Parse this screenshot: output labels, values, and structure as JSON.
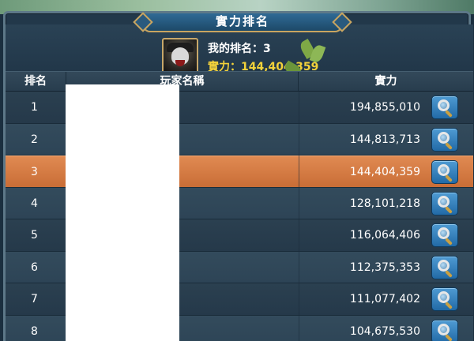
{
  "title": "實力排名",
  "my_rank": {
    "rank_label": "我的排名：3",
    "power_label": "實力：144,404,359"
  },
  "table": {
    "headers": [
      "排名",
      "玩家名稱",
      "實力"
    ],
    "rows": [
      {
        "rank": "1",
        "power": "194,855,010"
      },
      {
        "rank": "2",
        "power": "144,813,713"
      },
      {
        "rank": "3",
        "power": "144,404,359"
      },
      {
        "rank": "4",
        "power": "128,101,218"
      },
      {
        "rank": "5",
        "power": "116,064,406"
      },
      {
        "rank": "6",
        "power": "112,375,353"
      },
      {
        "rank": "7",
        "power": "111,077,402"
      },
      {
        "rank": "8",
        "power": "104,675,530"
      }
    ]
  },
  "icons": {
    "view_button": "magnifier-icon",
    "avatar": "player-avatar"
  },
  "colors": {
    "highlight_row": "#d57a42",
    "my_power": "#f3d23a",
    "title_banner": "#2a5a7e"
  }
}
